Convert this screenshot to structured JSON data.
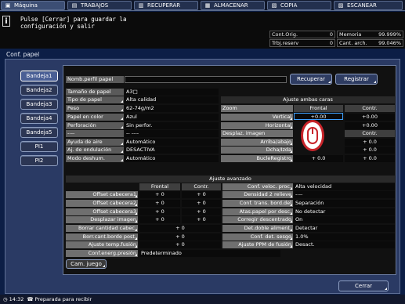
{
  "tabs": [
    {
      "label": "Máquina",
      "icon": "machine-icon"
    },
    {
      "label": "TRABAJOS",
      "icon": "jobs-icon"
    },
    {
      "label": "RECUPERAR",
      "icon": "recall-icon"
    },
    {
      "label": "ALMACENAR",
      "icon": "store-icon"
    },
    {
      "label": "COPIA",
      "icon": "copy-icon"
    },
    {
      "label": "ESCANEAR",
      "icon": "scan-icon"
    }
  ],
  "message": "Pulse [Cerrar] para guardar la\nconfiguración y salir",
  "status": {
    "cont_orig_label": "Cont.Orig.",
    "cont_orig_value": "0",
    "memoria_label": "Memoria",
    "memoria_value": "99.999%",
    "trbj_label": "Trbj.reserv",
    "trbj_value": "0",
    "cant_label": "Cant. arch.",
    "cant_value": "99.046%"
  },
  "page_title": "Conf. papel",
  "trays": [
    "Bandeja1",
    "Bandeja2",
    "Bandeja3",
    "Bandeja4",
    "Bandeja5",
    "PI1",
    "PI2"
  ],
  "profile": {
    "label": "Nomb.perfil papel",
    "value": "",
    "recuperar": "Recuperar",
    "registrar": "Registrar"
  },
  "basic": [
    {
      "label": "Tamaño de papel",
      "value": "A3□"
    },
    {
      "label": "Tipo de papel",
      "value": "Alta calidad"
    },
    {
      "label": "Peso",
      "value": "62-74g/m2"
    },
    {
      "label": "Papel en color",
      "value": "Azul"
    },
    {
      "label": "Perforación",
      "value": "Sin perfor."
    },
    {
      "label": "----",
      "value": "-- ----"
    },
    {
      "label": "Ayuda de aire",
      "value": "Automático"
    },
    {
      "label": "Aj. de ondulación",
      "value": "DESACTIVA"
    },
    {
      "label": "Modo deshum.",
      "value": "Automático"
    }
  ],
  "faces": {
    "title": "Ajuste ambas caras",
    "zoom": "Zoom",
    "frontal": "Frontal",
    "contr": "Contr.",
    "vertical": "Vertical",
    "vertical_f": "+0.00",
    "vertical_c": "+0.00",
    "horizontal": "Horizontal",
    "horizontal_c": "+0.00",
    "desplaz": "Desplaz. imagen",
    "desplaz_c": "Contr.",
    "arriba": "Arriba/abajo",
    "arriba_c": "+ 0.0",
    "dcha": "Dcha/Izda",
    "dcha_c": "+ 0.0",
    "bucle": "BucleRegistro",
    "bucle_f": "+ 0.0",
    "bucle_c": "+ 0.0"
  },
  "advanced": {
    "title": "Ajuste avanzado",
    "frontal": "Frontal",
    "contr": "Contr.",
    "left_rows": [
      {
        "label": "Offset cabecera1",
        "f": "+ 0",
        "c": "+ 0"
      },
      {
        "label": "Offset cabecera2",
        "f": "+ 0",
        "c": "+ 0"
      },
      {
        "label": "Offset cabecera3",
        "f": "+ 0",
        "c": "+ 0"
      },
      {
        "label": "Desplazar imagen",
        "f": "+ 0",
        "c": "+ 0"
      },
      {
        "label": "Borrar cantidad cabec.",
        "v": "+ 0"
      },
      {
        "label": "Borr.cant.borde post.",
        "v": "+ 0"
      },
      {
        "label": "Ajuste temp.fusión",
        "v": "+ 0"
      }
    ],
    "energ_label": "Conf.energ.presión",
    "energ_value": "Predeterminado",
    "right_rows": [
      {
        "label": "Conf. veloc. proc.",
        "v": "Alta velocidad"
      },
      {
        "label": "Densidad 2 relieve",
        "v": "----"
      },
      {
        "label": "Conf. trans. bord.del",
        "v": "Separación"
      },
      {
        "label": "Atas.papel por desc.",
        "v": "No detectar"
      },
      {
        "label": "Corregir descentrado",
        "v": "On"
      },
      {
        "label": "Det.doble aliment.",
        "v": "Detectar"
      },
      {
        "label": "Conf. det. sesgo",
        "v": "1.0%"
      },
      {
        "label": "Ajuste PPM de fusión",
        "v": "Desact."
      }
    ]
  },
  "cam_juego": "Cam. juego",
  "cerrar": "Cerrar",
  "bottom": {
    "time": "14:32",
    "status": "Preparada para recibir"
  }
}
